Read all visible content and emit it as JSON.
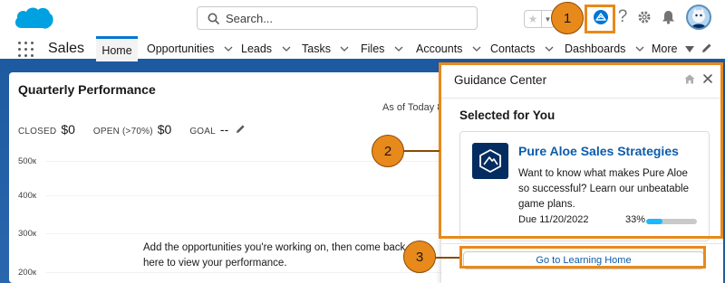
{
  "header": {
    "search_placeholder": "Search...",
    "icons": [
      "salesforce-cloud",
      "search",
      "star",
      "guidance-center",
      "help",
      "gear",
      "bell",
      "avatar"
    ]
  },
  "nav": {
    "app_name": "Sales",
    "tabs": [
      "Home",
      "Opportunities",
      "Leads",
      "Tasks",
      "Files",
      "Accounts",
      "Contacts",
      "Dashboards",
      "More"
    ],
    "active_tab": "Home"
  },
  "performance": {
    "title": "Quarterly Performance",
    "as_of": "As of Today 8",
    "closed_label": "CLOSED",
    "closed_value": "$0",
    "open_label": "OPEN (>70%)",
    "open_value": "$0",
    "goal_label": "GOAL",
    "goal_value": "--",
    "axis_labels": [
      "500к",
      "400к",
      "300к",
      "200к"
    ],
    "empty_message": "Add the opportunities you're working on, then come back here to view your performance."
  },
  "guidance": {
    "title": "Guidance Center",
    "section": "Selected for You",
    "item_title": "Pure Aloe Sales Strategies",
    "item_desc": "Want to know what makes Pure Aloe so successful? Learn our unbeatable game plans.",
    "due": "Due 11/20/2022",
    "progress_label": "33%",
    "progress": 0.33,
    "learning_home": "Go to Learning Home"
  },
  "callouts": [
    "1",
    "2",
    "3"
  ],
  "colors": {
    "brand_blue": "#0176d3",
    "link_blue": "#0b5cab",
    "callout_orange": "#e8891c",
    "progress_blue": "#1ab9ff",
    "tile_navy": "#032d60"
  }
}
